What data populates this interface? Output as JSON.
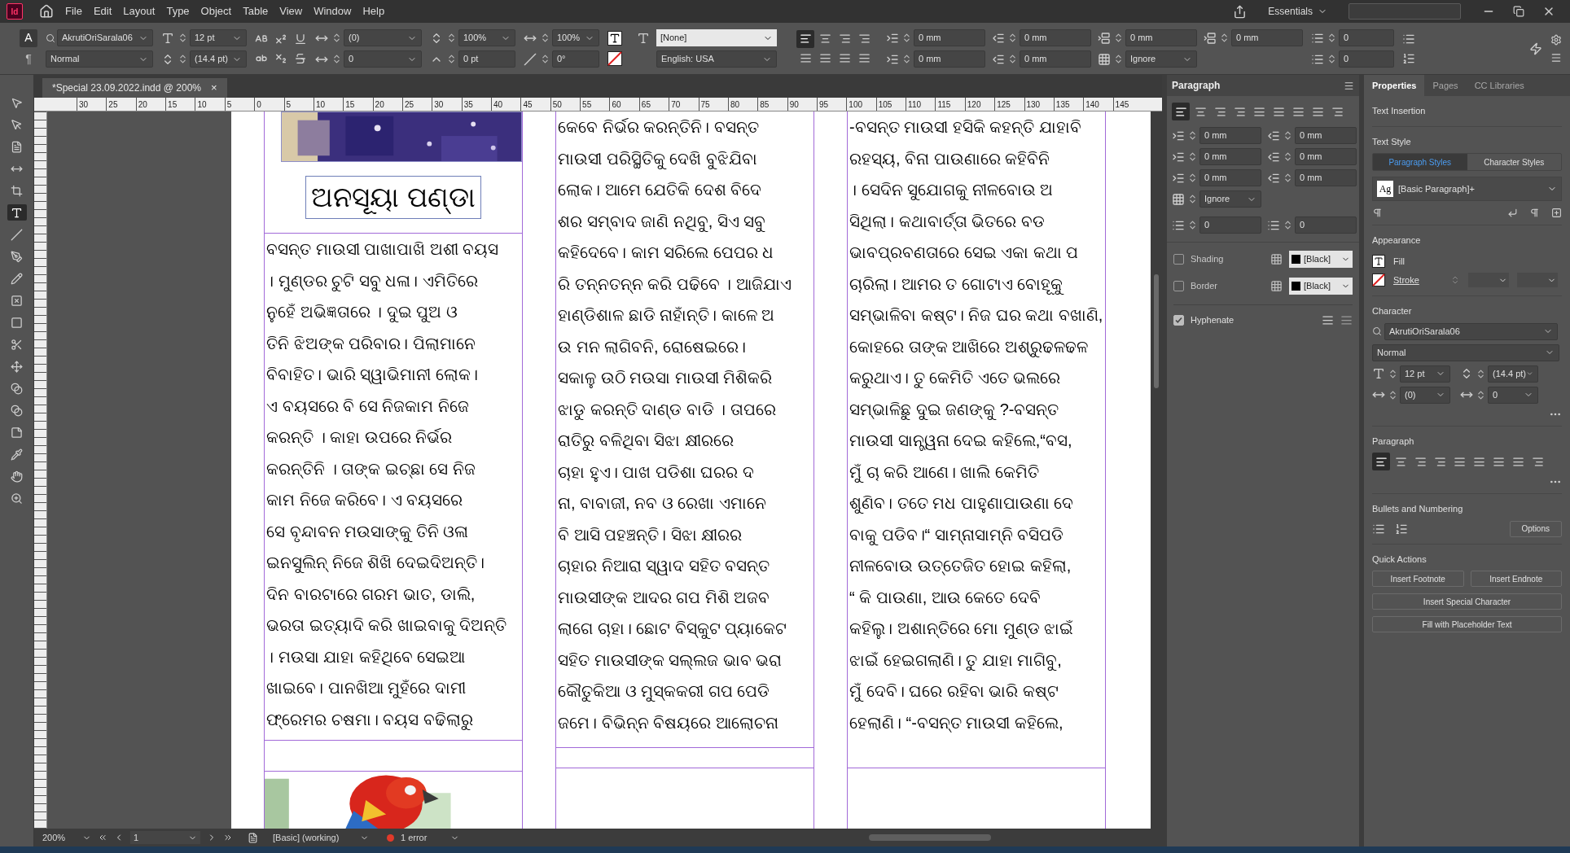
{
  "app": {
    "logo": "Id",
    "menu": [
      "File",
      "Edit",
      "Layout",
      "Type",
      "Object",
      "Table",
      "View",
      "Window",
      "Help"
    ],
    "workspace": "Essentials"
  },
  "control_panel": {
    "modes": [
      {
        "label": "A",
        "selected": true
      },
      {
        "label": "¶",
        "selected": false
      }
    ],
    "font": "AkrutiOriSarala06",
    "style": "Normal",
    "size": "12 pt",
    "leading": "(14.4 pt)",
    "kerning": "(0)",
    "tracking": "0",
    "vertical_scale": "100%",
    "baseline_shift": "0 pt",
    "horizontal_scale": "100%",
    "skew": "0°",
    "character_style": "[None]",
    "language": "English: USA",
    "alignment": [
      {
        "selected": true
      },
      {
        "selected": false
      },
      {
        "selected": false
      },
      {
        "selected": false
      },
      {
        "selected": false
      },
      {
        "selected": false
      },
      {
        "selected": false
      },
      {
        "selected": false
      }
    ],
    "fields_row1": [
      "0 mm",
      "0 mm",
      "0 mm",
      "0 mm",
      "0"
    ],
    "fields_row2": [
      "0 mm",
      "0 mm",
      "Ignore",
      "0"
    ]
  },
  "document_tab": {
    "title": "*Special 23.09.2022.indd @ 200%",
    "close": "×"
  },
  "ruler": [
    "30",
    "25",
    "20",
    "15",
    "10",
    "5",
    "0",
    "5",
    "10",
    "15",
    "20",
    "25",
    "30",
    "35",
    "40",
    "45",
    "50",
    "55",
    "60",
    "65",
    "70",
    "75",
    "80",
    "85",
    "90",
    "95",
    "100",
    "105",
    "110",
    "115",
    "120",
    "125",
    "130",
    "135",
    "140",
    "145"
  ],
  "tools": [
    {
      "kind": "select",
      "selected": false
    },
    {
      "kind": "direct",
      "selected": false
    },
    {
      "kind": "page",
      "selected": false
    },
    {
      "kind": "gap",
      "selected": false
    },
    {
      "kind": "collector",
      "selected": false
    },
    {
      "kind": "type",
      "selected": true
    },
    {
      "kind": "line",
      "selected": false
    },
    {
      "kind": "pen",
      "selected": false
    },
    {
      "kind": "pencil",
      "selected": false
    },
    {
      "kind": "frame",
      "selected": false
    },
    {
      "kind": "rectangle",
      "selected": false
    },
    {
      "kind": "scissors",
      "selected": false
    },
    {
      "kind": "transform",
      "selected": false
    },
    {
      "kind": "gradient",
      "selected": false
    },
    {
      "kind": "gradient",
      "selected": false
    },
    {
      "kind": "note",
      "selected": false
    },
    {
      "kind": "eyedropper",
      "selected": false
    },
    {
      "kind": "hand",
      "selected": false
    },
    {
      "kind": "zoom",
      "selected": false
    }
  ],
  "page": {
    "heading": "ଅନସୂୟା ପଣ୍ଡା",
    "columns": [
      {
        "lines": [
          "ବସନ୍ତ ମାଉସୀ ପାଖାପାଖି ଅଶୀ ବୟସ",
          "। ମୁଣ୍ଡର ଚୁଟି ସବୁ ଧଳା। ଏମିତିରେ",
          "ନୁହେଁ ଅଭିଜ୍ଞତାରେ । ଦୁଇ ପୁଅ ଓ",
          "ତିନି ଝିଅଙ୍କ ପରିବାର। ପିଲାମାନେ",
          "ବିବାହିତ। ଭାରି ସ୍ୱାଭିମାନୀ ଲୋକ।",
          "ଏ ବୟସରେ ବି ସେ ନିଜକାମ ନିଜେ",
          "କରନ୍ତି । କାହା ଉପରେ ନିର୍ଭର",
          "କରନ୍ତିନି । ତାଙ୍କ ଇଚ୍ଛା ସେ ନିଜ",
          "କାମ ନିଜେ କରିବେ। ଏ ବୟସରେ",
          "ସେ ବୃନ୍ଦାବନ ମଉସାଙ୍କୁ ତିନି ଓଳା",
          "ଇନସୁଲିନ୍ ନିଜେ ଶିଖି ଦେଇଦିଅନ୍ତି।",
          "ଦିନ ବାରଟାରେ ଗରମ ଭାତ, ଡାଲି,",
          "ଭରତା ଇତ୍ୟାଦି କରି ଖାଇବାକୁ ଦିଅନ୍ତି",
          "। ମଉସା ଯାହା କହିଥିବେ ସେଇଆ",
          "ଖାଇବେ। ପାନଖିଆ ମୁହଁରେ ଦାମୀ",
          "ଫ୍ରେମର ଚଷମା। ବୟସ ବଢିଲାରୁ"
        ]
      },
      {
        "lines": [
          "କେବେ ନିର୍ଭର କରନ୍ତିନି। ବସନ୍ତ",
          "ମାଉସୀ ପରିସ୍ଥିତିକୁ ଦେଖି ବୁଝିଯିବା",
          "ଲୋକ। ଆମେ ଯେତିକି ଦେଶ ବିଦେ",
          "ଶର ସମ୍ବାଦ ଜାଣି ନଥିବୁ, ସିଏ ସବୁ",
          "କହିଦେବେ। କାମ ସରିଲେ ପେପର ଧ",
          "ରି ତନ୍ନତନ୍ନ କରି ପଢିବେ । ଆଜିଯାଏ",
          "ହାଣ୍ଡିଶାଳ ଛାଡି ନାହାଁନ୍ତି। କାଳେ ଅ",
          "ଉ ମନ ଲାଗିବନି, ରୋଷେଇରେ।",
          "ସକାଳୁ ଉଠି ମଉସା ମାଉସୀ ମିଶିକରି",
          "ଝାଡୁ କରନ୍ତି ଦାଣ୍ଡ ବାଡି । ତାପରେ",
          "ରାତିରୁ ବଳିଥିବା ସିଝା କ୍ଷୀରରେ",
          "ଚାହା ହୁଏ। ପାଖ ପଡିଶା ଘରର ଦ",
          "ନା, ବାବାଜୀ, ନବ ଓ ରେଖା ଏମାନେ",
          "ବି ଆସି ପହଞ୍ଚନ୍ତି। ସିଝା କ୍ଷୀରର",
          "ଚାହାର ନିଆରା ସ୍ୱାଦ ସହିତ ବସନ୍ତ",
          "ମାଉସୀଙ୍କ ଆଦର ଗପ ମିଶି ଅଜବ",
          "ଲାଗେ ଚାହା। ଛୋଟ ବିସ୍କୁଟ ପ୍ୟାକେଟ",
          "ସହିତ ମାଉସୀଙ୍କ ସଲ୍ଲଜ ଭାବ ଭରା",
          "କୌତୁକିଆ ଓ ମୁସ୍କକରୀ ଗପ ପେଡି",
          "ଜମେ। ବିଭିନ୍ନ ବିଷୟରେ ଆଲୋଚନା"
        ]
      },
      {
        "lines": [
          "-ବସନ୍ତ ମାଉସୀ ହସିକି କହନ୍ତି ଯାହାବି",
          "ରହସ୍ୟ, ବିନା ପାଉଣାରେ କହିବିନି",
          "। ସେଦିନ ସୁଯୋଗକୁ ନୀଳବୋଉ ଅ",
          "ସିଥିଲା। କଥାବାର୍ତ୍ତା ଭିତରେ ବଡ",
          "ଭାବପ୍ରବଣତାରେ ସେଇ ଏକା କଥା ପ",
          "ଚାରିଲା। ଆମର ତ ଗୋଟାଏ ବୋହୂକୁ",
          "ସମ୍ଭାଳିବା କଷ୍ଟ। ନିଜ ଘର କଥା ବଖାଣି,",
          "କୋହରେ ତାଙ୍କ ଆଖିରେ ଅଶ୍ରୁଢଳଢଳ",
          "କରୁଥାଏ। ତୁ କେମିତି ଏତେ ଭଲରେ",
          "ସମ୍ଭାଳିଛୁ ଦୁଇ ଜଣଙ୍କୁ ?-ବସନ୍ତ",
          "ମାଉସୀ ସାନ୍ତ୍ୱନା ଦେଇ କହିଲେ,“ବସ,",
          "ମୁଁ ଚା କରି ଆଣେ। ଖାଲି କେମିତି",
          "ଶୁଣିବ। ତତେ ମଧ ପାହୁଣାପାଉଣା ଦେ",
          "ବାକୁ ପଡିବ।“ ସାମ୍ନାସାମ୍ନି ବସିପଡି",
          "ନୀଳବୋଉ ଉତ୍ତେଜିତ ହୋଇ କହିଲା,",
          "“ କି ପାଉଣା, ଆଉ କେତେ ଦେବି",
          "କହିଲୁ। ଅଶାନ୍ତିରେ ମୋ ମୁଣ୍ଡ ଝାଇଁ",
          "ଝାଇଁ ହେଇଗଲାଣି। ତୁ ଯାହା ମାଗିବୁ,",
          "ମୁଁ ଦେବି। ଘରେ ରହିବା ଭାରି କଷ୍ଟ",
          "ହେଲାଣି। “-ବସନ୍ତ ମାଉସୀ କହିଲେ,"
        ]
      }
    ]
  },
  "status_bar": {
    "zoom": "200%",
    "page": "1",
    "style": "[Basic] (working)",
    "errors": "1 error"
  },
  "paragraph_panel": {
    "title": "Paragraph",
    "alignment": [
      {
        "selected": true
      },
      {
        "selected": false
      },
      {
        "selected": false
      },
      {
        "selected": false
      },
      {
        "selected": false
      },
      {
        "selected": false
      },
      {
        "selected": false
      },
      {
        "selected": false
      },
      {
        "selected": false
      }
    ],
    "fields": [
      "0 mm",
      "0 mm",
      "0 mm",
      "0 mm",
      "0 mm",
      "0 mm"
    ],
    "grid": "Ignore",
    "drop_cap": [
      "0",
      "0"
    ],
    "shading": {
      "label": "Shading",
      "checked": false,
      "swatch": "[Black]"
    },
    "border": {
      "label": "Border",
      "checked": false,
      "swatch": "[Black]"
    },
    "hyphenate": {
      "label": "Hyphenate",
      "checked": true
    }
  },
  "properties_panel": {
    "tabs": [
      {
        "label": "Properties",
        "selected": true
      },
      {
        "label": "Pages",
        "selected": false
      },
      {
        "label": "CC Libraries",
        "selected": false
      }
    ],
    "text_insertion": "Text Insertion",
    "text_style": "Text Style",
    "style_tabs": [
      {
        "label": "Paragraph Styles",
        "selected": true
      },
      {
        "label": "Character Styles",
        "selected": false
      }
    ],
    "style_badge": "Ag",
    "style": "[Basic Paragraph]+",
    "appearance": "Appearance",
    "fill": "Fill",
    "stroke": "Stroke",
    "character": "Character",
    "font": "AkrutiOriSarala06",
    "font_style": "Normal",
    "size": "12 pt",
    "leading": "(14.4 pt)",
    "kerning": "(0)",
    "tracking": "0",
    "paragraph": "Paragraph",
    "alignment": [
      {
        "selected": true
      },
      {
        "selected": false
      },
      {
        "selected": false
      },
      {
        "selected": false
      },
      {
        "selected": false
      },
      {
        "selected": false
      },
      {
        "selected": false
      },
      {
        "selected": false
      },
      {
        "selected": false
      }
    ],
    "bullets": "Bullets and Numbering",
    "options": "Options",
    "quick_actions": "Quick Actions",
    "actions": [
      "Insert Footnote",
      "Insert Endnote",
      "Insert Special Character",
      "Fill with Placeholder Text"
    ]
  }
}
